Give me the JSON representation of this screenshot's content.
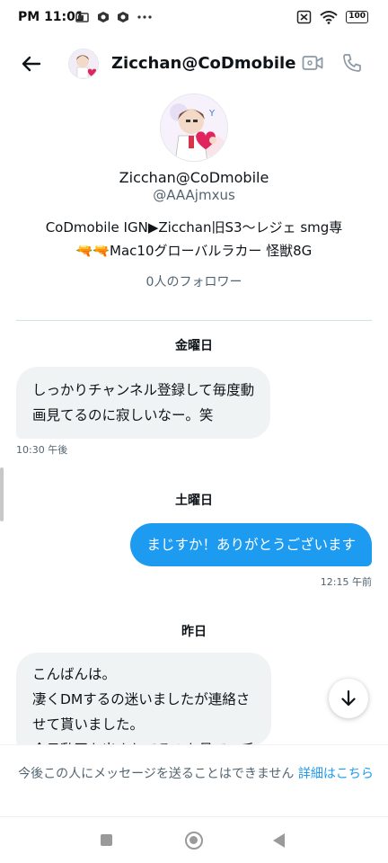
{
  "status_bar": {
    "time": "PM 11:01",
    "battery": "100",
    "icons": [
      "sim-icon",
      "app-notification-icon",
      "app-notification-icon",
      "more-dots-icon",
      "no-sim-icon",
      "wifi-icon",
      "battery-icon"
    ]
  },
  "header": {
    "title": "Zicchan@CoDmobile",
    "icons": [
      "back-arrow-icon",
      "video-call-icon",
      "phone-call-icon"
    ]
  },
  "profile": {
    "name": "Zicchan@CoDmobile",
    "handle": "@AAAjmxus",
    "bio_line1": "CoDmobile IGN▶Zicchan旧S3〜レジェ smg専",
    "bio_line2": "🔫🔫Mac10グローバルラカー 怪獣8G",
    "followers": "0人のフォロワー"
  },
  "conversation": {
    "day1": "金曜日",
    "msg1_line1": "しっかりチャンネル登録して毎度動",
    "msg1_line2": "画見てるのに寂しいなー。笑",
    "msg1_time": "10:30 午後",
    "day2": "土曜日",
    "msg2": "まじすか！ありがとうございます",
    "msg2_time": "12:15 午前",
    "day3": "昨日",
    "msg3_line1": "こんばんは。",
    "msg3_line2": "凄くDMするの迷いましたが連絡さ",
    "msg3_line3": "せて貰いました。",
    "msg3_line4": "今日動画を出されてるのを見て　千"
  },
  "footer": {
    "notice_text": "今後この人にメッセージを送ることはできません",
    "notice_link": "詳細はこちら"
  },
  "colors": {
    "accent": "#1d9bf0",
    "incoming_bubble": "#eff3f4",
    "secondary_text": "#536471"
  }
}
